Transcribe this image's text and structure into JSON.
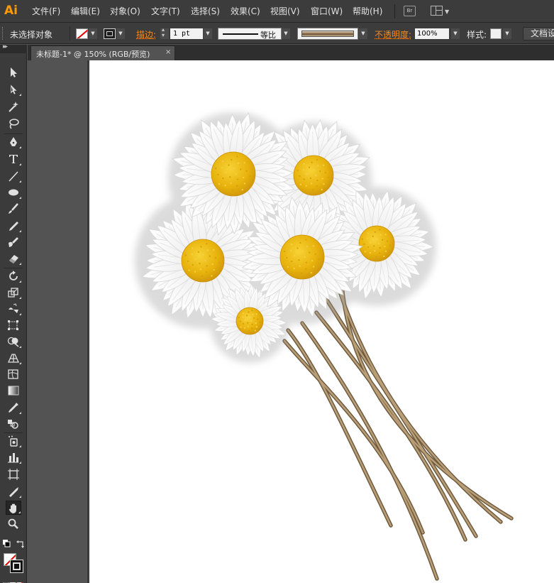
{
  "app": {
    "logo": "Ai"
  },
  "menu": [
    {
      "label": "文件(F)"
    },
    {
      "label": "编辑(E)"
    },
    {
      "label": "对象(O)"
    },
    {
      "label": "文字(T)"
    },
    {
      "label": "选择(S)"
    },
    {
      "label": "效果(C)"
    },
    {
      "label": "视图(V)"
    },
    {
      "label": "窗口(W)"
    },
    {
      "label": "帮助(H)"
    }
  ],
  "bridge_label": "Br",
  "control": {
    "selection": "未选择对象",
    "stroke_label": "描边:",
    "stroke_weight": "1 pt",
    "profile": "等比",
    "opacity_label": "不透明度:",
    "opacity_value": "100%",
    "style_label": "样式:",
    "doc_setup": "文档设置"
  },
  "document": {
    "tab_title": "未标题-1* @ 150% (RGB/预览)",
    "close": "×"
  },
  "colors": {
    "accent": "#f08a24",
    "logo": "#ff9a00",
    "flower_center": "#e8b20c",
    "stem": "#8b7355"
  },
  "tools": [
    {
      "icon": "selection-tool-icon"
    },
    {
      "icon": "direct-selection-tool-icon"
    },
    {
      "icon": "magic-wand-tool-icon"
    },
    {
      "icon": "lasso-tool-icon"
    },
    {
      "icon": "pen-tool-icon"
    },
    {
      "icon": "type-tool-icon"
    },
    {
      "icon": "line-segment-tool-icon"
    },
    {
      "icon": "ellipse-tool-icon"
    },
    {
      "icon": "paintbrush-tool-icon"
    },
    {
      "icon": "pencil-tool-icon"
    },
    {
      "icon": "blob-brush-tool-icon"
    },
    {
      "icon": "eraser-tool-icon"
    },
    {
      "icon": "rotate-tool-icon"
    },
    {
      "icon": "scale-tool-icon"
    },
    {
      "icon": "warp-tool-icon"
    },
    {
      "icon": "free-transform-tool-icon"
    },
    {
      "icon": "shape-builder-tool-icon"
    },
    {
      "icon": "perspective-grid-tool-icon"
    },
    {
      "icon": "mesh-tool-icon"
    },
    {
      "icon": "gradient-tool-icon"
    },
    {
      "icon": "eyedropper-tool-icon"
    },
    {
      "icon": "blend-tool-icon"
    },
    {
      "icon": "symbol-sprayer-tool-icon"
    },
    {
      "icon": "column-graph-tool-icon"
    },
    {
      "icon": "artboard-tool-icon"
    },
    {
      "icon": "slice-tool-icon"
    },
    {
      "icon": "hand-tool-icon"
    },
    {
      "icon": "zoom-tool-icon"
    }
  ]
}
